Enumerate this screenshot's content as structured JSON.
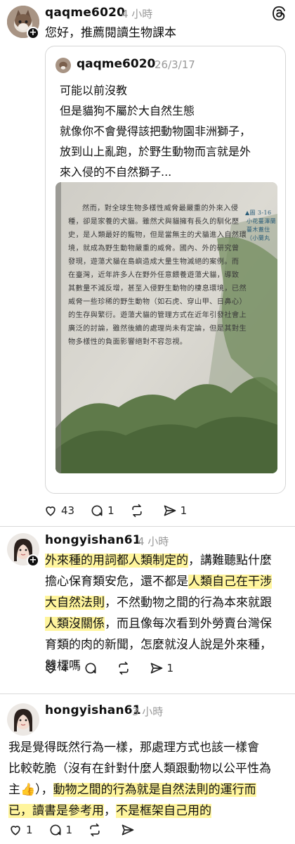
{
  "threads_logo": "threads-logo",
  "post1": {
    "username": "qaqme6020",
    "time": "4 小時",
    "text": "您好，推薦閱讀生物課本",
    "quote": {
      "username": "qaqme6020",
      "date": "26/3/17",
      "lines": [
        "可能以前沒教",
        "但是貓狗不屬於大自然生態",
        "就像你不會覺得該把動物園非洲獅子，",
        "放到山上亂跑，於野生動物而言就是外",
        "來入侵的不自然獅子..."
      ],
      "book_page": {
        "lines": [
          "然而，對全球生物多樣性威脅最嚴重的外來入侵",
          "種，卻是家養的犬貓。雖然犬與貓擁有長久的馴化歷",
          "史，是人類最好的寵物，但是當無主的犬貓進入自然環",
          "境，就成為野生動物嚴重的威脅。國內、外的研究曾",
          "發現，遊蕩犬貓在島嶼造成大量生物滅絕的案例。而",
          "在臺灣，近年許多人在野外任意餵養遊蕩犬貓，導致",
          "其數量不減反增，甚至入侵野生動物的棲息環境，已然",
          "威脅一些珍稀的野生動物（如石虎、穿山甲、日鼻心）",
          "的生存與繁衍。遊蕩犬貓的管理方式在近年引發社會上",
          "廣泛的討論，雖然後續的處理尚未有定論，但是其對生",
          "物多樣性的負面影響絕對不容忽視。"
        ],
        "caption_lines": [
          "▲圖 3-16",
          "小花蔓澤蘭",
          "蔓木蓋住",
          "（小蘭丸"
        ]
      }
    },
    "likes": "43",
    "replies": "1",
    "reposts": "",
    "shares": "1"
  },
  "post2": {
    "username": "hongyishan61",
    "time": "4 小時",
    "lines": [
      [
        {
          "t": "外來種的用詞都人類制定的",
          "h": true
        },
        {
          "t": "，講難聽點什麼",
          "h": false
        }
      ],
      [
        {
          "t": "擔心保育類安危，還不都是",
          "h": false
        },
        {
          "t": "人類自己在干涉",
          "h": true
        }
      ],
      [
        {
          "t": "大自然法則",
          "h": true
        },
        {
          "t": "，不然動物之間的行為本來就跟",
          "h": false
        }
      ],
      [
        {
          "t": "人類沒關係",
          "h": true
        },
        {
          "t": "，而且像每次看到外勞賣台灣保",
          "h": false
        }
      ],
      [
        {
          "t": "育類的肉的新聞，怎麼就沒人說是外來種，",
          "h": false
        }
      ],
      [
        {
          "t": "雙標嗎",
          "h": false
        }
      ]
    ],
    "likes": "4",
    "replies": "",
    "reposts": "",
    "shares": "1"
  },
  "post3": {
    "username": "hongyishan61",
    "time": "3 小時",
    "lines": [
      [
        {
          "t": "我是覺得既然行為一樣，那處理方式也該一樣會",
          "h": false
        }
      ],
      [
        {
          "t": "比較乾脆（沒有在針對什麼人類跟動物以公平性為",
          "h": false
        }
      ],
      [
        {
          "t": "主👍），",
          "h": false
        },
        {
          "t": "動物之間的行為就是自然法則的運行而",
          "h": true
        }
      ],
      [
        {
          "t": "已，讀書是參考用",
          "h": true
        },
        {
          "t": "，",
          "h": false
        },
        {
          "t": "不是框架自己用的",
          "h": true
        }
      ]
    ],
    "likes": "1",
    "replies": "1",
    "reposts": "",
    "shares": ""
  },
  "colors": {
    "highlight": "#fff59d",
    "muted": "#999999",
    "text": "#101010"
  }
}
